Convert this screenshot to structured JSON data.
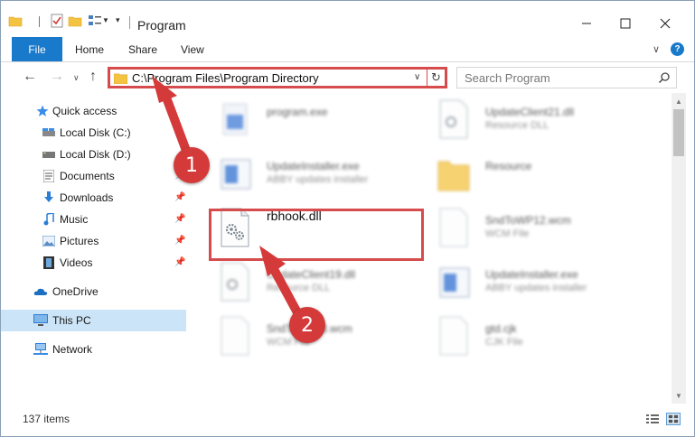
{
  "window": {
    "title": "Program",
    "minimize_icon": "minimize-icon",
    "maximize_icon": "maximize-icon",
    "close_icon": "close-icon"
  },
  "ribbon": {
    "tabs": [
      {
        "label": "File",
        "active": true
      },
      {
        "label": "Home"
      },
      {
        "label": "Share"
      },
      {
        "label": "View"
      }
    ],
    "help_label": "?"
  },
  "nav": {
    "address_path": "C:\\Program Files\\Program Directory",
    "search_placeholder": "Search Program"
  },
  "sidebar": {
    "items": [
      {
        "label": "Quick access",
        "icon": "star-icon"
      },
      {
        "label": "Local Disk (C:)",
        "icon": "drive-icon"
      },
      {
        "label": "Local Disk (D:)",
        "icon": "drive-icon"
      },
      {
        "label": "Documents",
        "icon": "documents-icon",
        "pinned": true
      },
      {
        "label": "Downloads",
        "icon": "downloads-icon",
        "pinned": true
      },
      {
        "label": "Music",
        "icon": "music-icon",
        "pinned": true
      },
      {
        "label": "Pictures",
        "icon": "pictures-icon",
        "pinned": true
      },
      {
        "label": "Videos",
        "icon": "videos-icon",
        "pinned": true
      },
      {
        "label": "OneDrive",
        "icon": "onedrive-icon"
      },
      {
        "label": "This PC",
        "icon": "computer-icon",
        "selected": true
      },
      {
        "label": "Network",
        "icon": "network-icon"
      }
    ]
  },
  "files": [
    {
      "name": "program.exe",
      "type": ""
    },
    {
      "name": "UpdateClient21.dll",
      "type": "Resource DLL"
    },
    {
      "name": "UpdateInstaller.exe",
      "type": "ABBY updates installer"
    },
    {
      "name": "Resource",
      "type": ""
    },
    {
      "name": "rbhook.dll",
      "type": ""
    },
    {
      "name": "SndToWP12.wcm",
      "type": "WCM File"
    },
    {
      "name": "UpdateClient19.dll",
      "type": "Resource DLL"
    },
    {
      "name": "UpdateInstaller.exe",
      "type": "ABBY updates installer"
    },
    {
      "name": "SndToWP13.wcm",
      "type": "WCM File"
    },
    {
      "name": "gtd.cjk",
      "type": "CJK File"
    }
  ],
  "status": {
    "item_count": "137 items"
  },
  "callouts": {
    "step1": "1",
    "step2": "2",
    "color": "#d53a3a"
  },
  "colors": {
    "accent": "#1979ca",
    "highlight": "#d64b4b",
    "selected_bg": "#cce4f7"
  }
}
